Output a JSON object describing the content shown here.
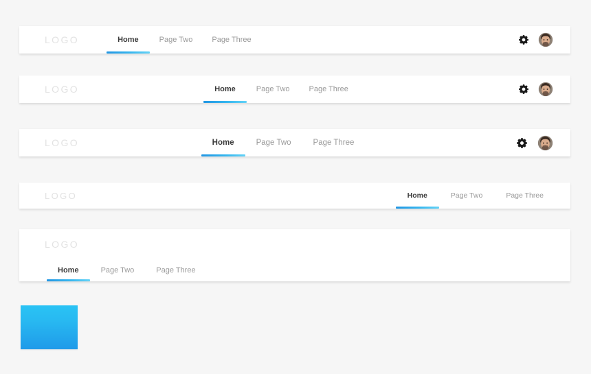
{
  "page": {
    "background_color": "#f6f6f6",
    "accent_color": "#2196e3",
    "accent_color_light": "#63d2f7",
    "logo_text_color": "#e2e2e2",
    "inactive_link_color": "#9a9a9a",
    "active_link_color": "#3c3c3c"
  },
  "navbars": [
    {
      "id": "navbar-left-aligned-with-actions",
      "logo": "LOGO",
      "links": [
        {
          "label": "Home",
          "active": true
        },
        {
          "label": "Page Two",
          "active": false
        },
        {
          "label": "Page Three",
          "active": false
        }
      ],
      "actions": {
        "settings_icon": "gear-icon",
        "avatar_icon": "user-avatar"
      }
    },
    {
      "id": "navbar-center-right-with-actions",
      "logo": "LOGO",
      "links": [
        {
          "label": "Home",
          "active": true
        },
        {
          "label": "Page Two",
          "active": false
        },
        {
          "label": "Page Three",
          "active": false
        }
      ],
      "actions": {
        "settings_icon": "gear-icon",
        "avatar_icon": "user-avatar"
      }
    },
    {
      "id": "navbar-right-aligned-with-actions",
      "logo": "LOGO",
      "links": [
        {
          "label": "Home",
          "active": true
        },
        {
          "label": "Page Two",
          "active": false
        },
        {
          "label": "Page Three",
          "active": false
        }
      ],
      "actions": {
        "settings_icon": "gear-icon",
        "avatar_icon": "user-avatar"
      }
    },
    {
      "id": "navbar-right-aligned-no-actions",
      "logo": "LOGO",
      "links": [
        {
          "label": "Home",
          "active": true
        },
        {
          "label": "Page Two",
          "active": false
        },
        {
          "label": "Page Three",
          "active": false
        }
      ]
    },
    {
      "id": "navbar-stacked-two-row",
      "logo": "LOGO",
      "links": [
        {
          "label": "Home",
          "active": true
        },
        {
          "label": "Page Two",
          "active": false
        },
        {
          "label": "Page Three",
          "active": false
        }
      ]
    }
  ],
  "swatch": {
    "name": "accent-gradient-swatch",
    "top_color": "#2ac3f4",
    "bottom_color": "#1f9ae9"
  }
}
